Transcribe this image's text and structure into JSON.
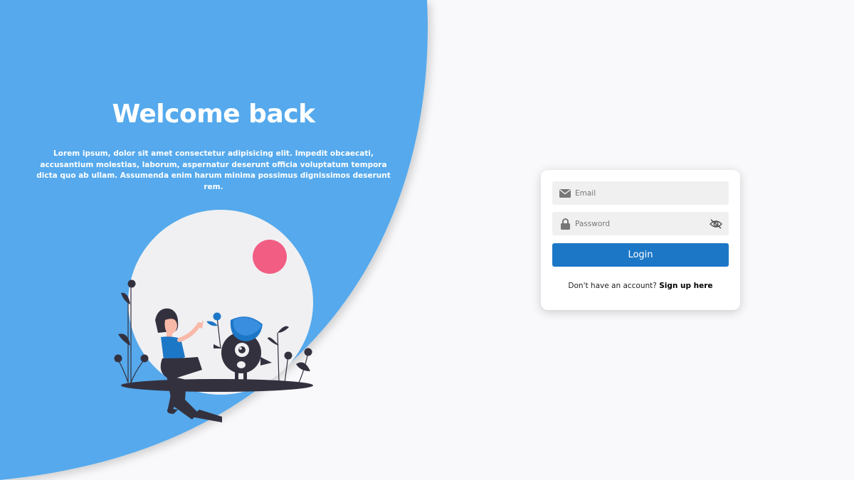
{
  "hero": {
    "title": "Welcome back",
    "description": "Lorem ipsum, dolor sit amet consectetur adipisicing elit. Impedit obcaecati, accusantium molestias, laborum, aspernatur deserunt officia voluptatum tempora dicta quo ab ullam. Assumenda enim harum minima possimus dignissimos deserunt rem.",
    "bg_color": "#55a9ec"
  },
  "login": {
    "email_placeholder": "Email",
    "password_placeholder": "Password",
    "email_icon": "envelope-icon",
    "password_icon": "lock-icon",
    "toggle_icon": "eye-slash-icon",
    "button_label": "Login",
    "button_color": "#1d77c7",
    "signup_prompt": "Don't have an account?",
    "signup_link": "Sign up here"
  }
}
